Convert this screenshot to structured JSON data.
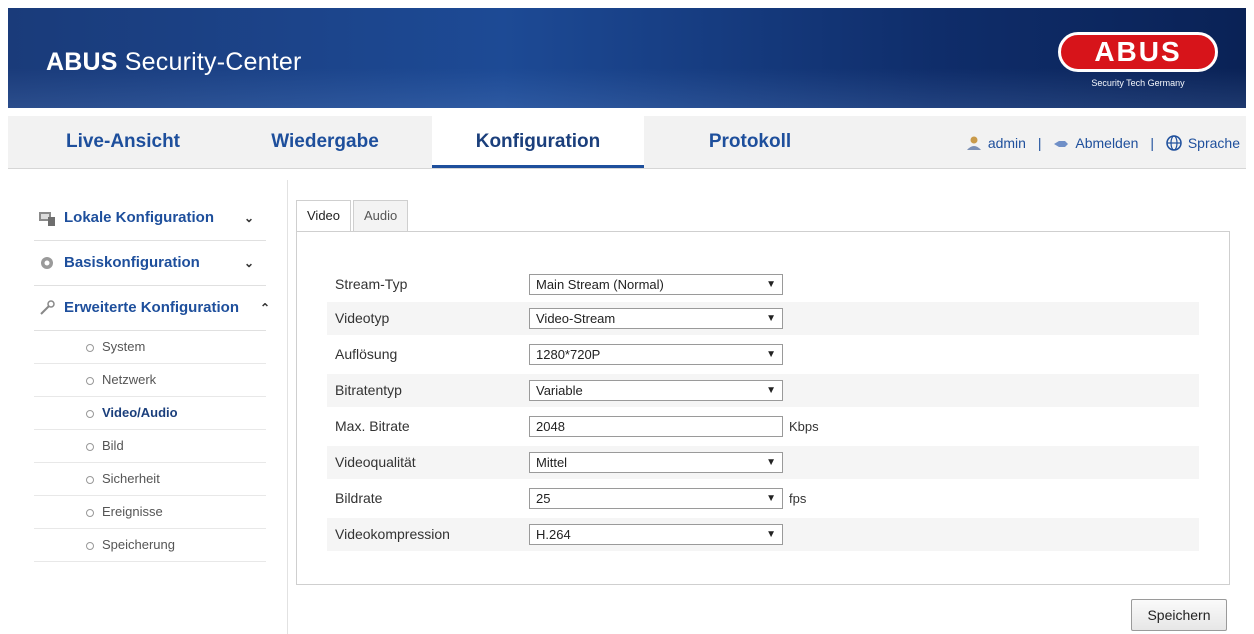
{
  "header": {
    "title_bold": "ABUS",
    "title_rest": "Security-Center",
    "logo_text": "ABUS",
    "logo_sub": "Security Tech Germany"
  },
  "nav": {
    "tabs": [
      "Live-Ansicht",
      "Wiedergabe",
      "Konfiguration",
      "Protokoll"
    ],
    "active": "Konfiguration",
    "user": "admin",
    "logout": "Abmelden",
    "language": "Sprache"
  },
  "sidebar": {
    "sections": [
      {
        "label": "Lokale Konfiguration",
        "icon": "computer-icon",
        "chevron": "⌄"
      },
      {
        "label": "Basiskonfiguration",
        "icon": "gear-icon",
        "chevron": "⌄"
      },
      {
        "label": "Erweiterte Konfiguration",
        "icon": "wrench-icon",
        "chevron": "⌃"
      }
    ],
    "items": [
      "System",
      "Netzwerk",
      "Video/Audio",
      "Bild",
      "Sicherheit",
      "Ereignisse",
      "Speicherung"
    ],
    "active_item": "Video/Audio"
  },
  "subtabs": [
    "Video",
    "Audio"
  ],
  "form": {
    "rows": [
      {
        "label": "Stream-Typ",
        "value": "Main Stream (Normal)",
        "type": "select",
        "unit": ""
      },
      {
        "label": "Videotyp",
        "value": "Video-Stream",
        "type": "select",
        "unit": ""
      },
      {
        "label": "Auflösung",
        "value": "1280*720P",
        "type": "select",
        "unit": ""
      },
      {
        "label": "Bitratentyp",
        "value": "Variable",
        "type": "select",
        "unit": ""
      },
      {
        "label": "Max. Bitrate",
        "value": "2048",
        "type": "input",
        "unit": "Kbps"
      },
      {
        "label": "Videoqualität",
        "value": "Mittel",
        "type": "select",
        "unit": ""
      },
      {
        "label": "Bildrate",
        "value": "25",
        "type": "select",
        "unit": "fps"
      },
      {
        "label": "Videokompression",
        "value": "H.264",
        "type": "select",
        "unit": ""
      }
    ]
  },
  "save_label": "Speichern",
  "colors": {
    "accent": "#1e4f9c",
    "logo_red": "#d7141a",
    "banner": "#1a3b7a"
  }
}
